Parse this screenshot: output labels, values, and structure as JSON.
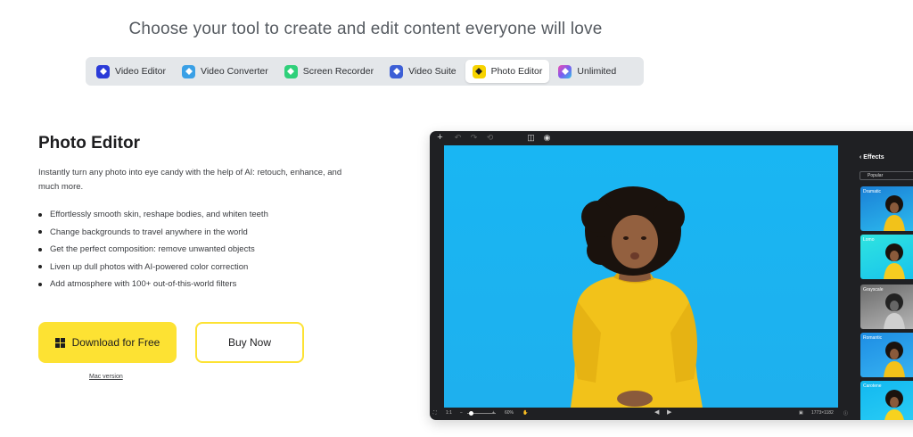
{
  "headline": "Choose your tool to create and edit content everyone will love",
  "tabs": [
    {
      "label": "Video Editor",
      "icon": "video-editor-icon",
      "color": "#2b3bd8",
      "active": false
    },
    {
      "label": "Video Converter",
      "icon": "video-converter-icon",
      "color": "#3aa0e6",
      "active": false
    },
    {
      "label": "Screen Recorder",
      "icon": "screen-recorder-icon",
      "color": "#2fd07a",
      "active": false
    },
    {
      "label": "Video Suite",
      "icon": "video-suite-icon",
      "color": "#3d5fd6",
      "active": false
    },
    {
      "label": "Photo Editor",
      "icon": "photo-editor-icon",
      "color": "#f7d300",
      "active": true
    },
    {
      "label": "Unlimited",
      "icon": "unlimited-icon",
      "color": "#9b5be0",
      "active": false
    }
  ],
  "product": {
    "title": "Photo Editor",
    "description": "Instantly turn any photo into eye candy with the help of AI: retouch, enhance, and much more.",
    "features": [
      "Effortlessly smooth skin, reshape bodies, and whiten teeth",
      "Change backgrounds to travel anywhere in the world",
      "Get the perfect composition: remove unwanted objects",
      "Liven up dull photos with AI-powered color correction",
      "Add atmosphere with 100+ out-of-this-world filters"
    ],
    "download_label": "Download for Free",
    "buy_label": "Buy Now",
    "mac_link": "Mac version"
  },
  "app": {
    "panel_title": "Effects",
    "panel_filter": "Popular",
    "effects": [
      "Dramatic",
      "Lomo",
      "Grayscale",
      "Romantic",
      "Carotene"
    ],
    "zoom": "1:1",
    "zoom_percent": "60%",
    "dimensions": "1773×1182"
  },
  "colors": {
    "accent": "#fde233",
    "canvas_bg": "#19b6f3",
    "app_bg": "#1f2023"
  }
}
